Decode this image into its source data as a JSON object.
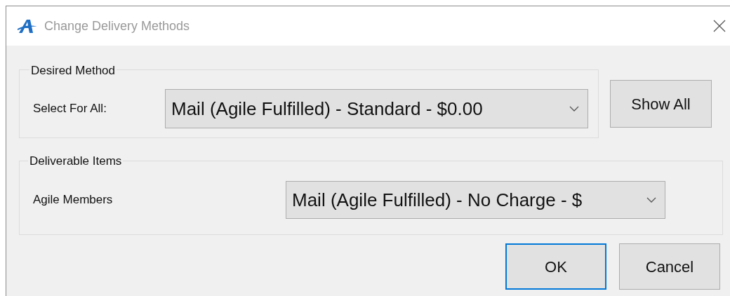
{
  "window": {
    "title": "Change Delivery Methods"
  },
  "desired_method": {
    "legend": "Desired Method",
    "label": "Select For All:",
    "value": "Mail (Agile Fulfilled) - Standard - $0.00",
    "button": "Show All"
  },
  "deliverable_items": {
    "legend": "Deliverable Items",
    "rows": [
      {
        "label": "Agile Members",
        "value": "Mail (Agile Fulfilled) - No Charge - $"
      }
    ]
  },
  "buttons": [
    {
      "label": "OK",
      "selected": true
    },
    {
      "label": "Cancel",
      "selected": false
    }
  ]
}
